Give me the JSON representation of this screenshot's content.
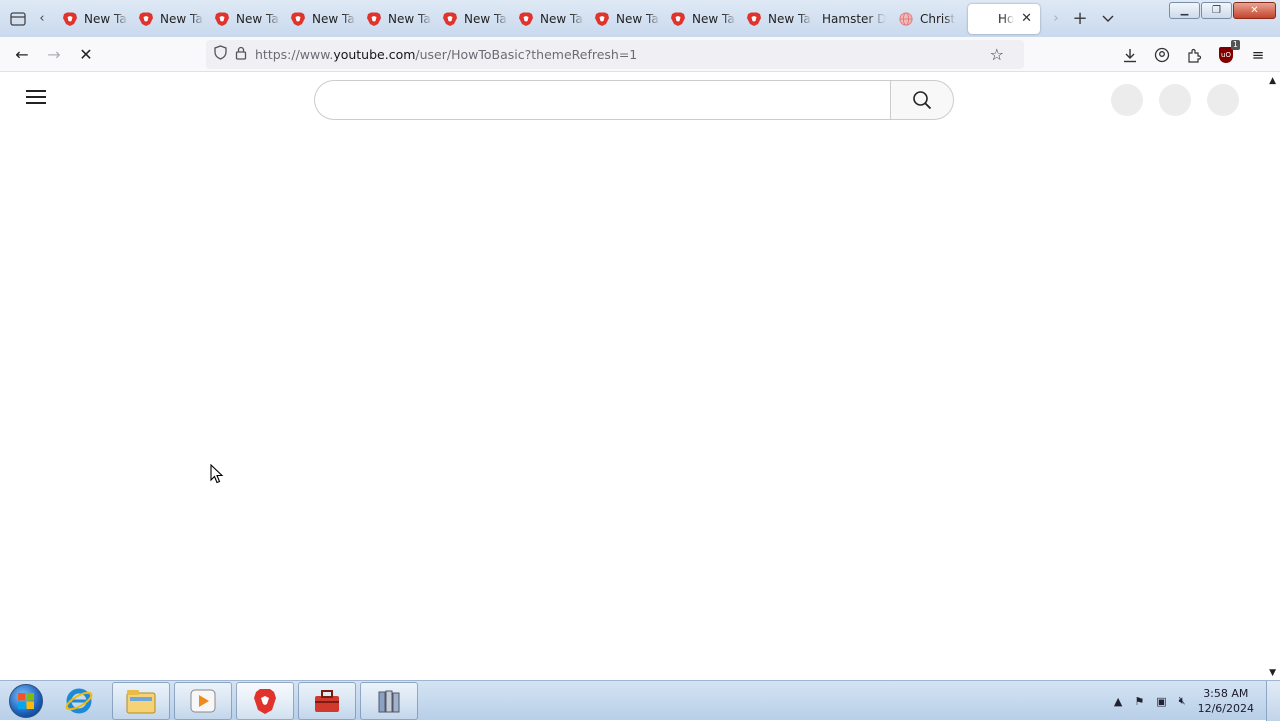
{
  "browser": {
    "tabs": [
      {
        "label": "New Tab",
        "icon": "brave-lion-icon"
      },
      {
        "label": "New Tab",
        "icon": "brave-lion-icon"
      },
      {
        "label": "New Tab",
        "icon": "brave-lion-icon"
      },
      {
        "label": "New Tab",
        "icon": "brave-lion-icon"
      },
      {
        "label": "New Tab",
        "icon": "brave-lion-icon"
      },
      {
        "label": "New Tab",
        "icon": "brave-lion-icon"
      },
      {
        "label": "New Tab",
        "icon": "brave-lion-icon"
      },
      {
        "label": "New Tab",
        "icon": "brave-lion-icon"
      },
      {
        "label": "New Tab",
        "icon": "brave-lion-icon"
      },
      {
        "label": "New Tab",
        "icon": "brave-lion-icon"
      },
      {
        "label": "Hamster D",
        "icon": null
      },
      {
        "label": "Christ",
        "icon": "globe-icon"
      }
    ],
    "active_tab": {
      "label": "Ho"
    },
    "url": {
      "prefix": "https://www.",
      "host": "youtube.com",
      "path": "/user/HowToBasic?themeRefresh=1"
    },
    "extension_badge": "1",
    "extension_icon_text": "uO"
  },
  "page": {
    "search": {
      "placeholder": ""
    }
  },
  "taskbar": {
    "clock": {
      "time": "3:58 AM",
      "date": "12/6/2024"
    }
  },
  "colors": {
    "brave_red": "#e0332b",
    "youtube_placeholder": "#ececec",
    "taskbar": "#c6d9ef"
  }
}
